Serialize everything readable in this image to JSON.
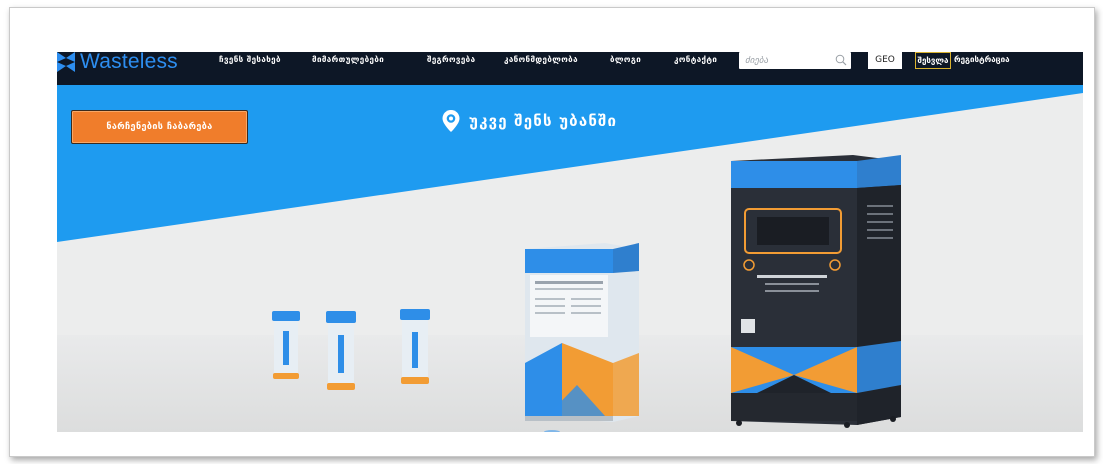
{
  "brand": {
    "name": "Wasteless"
  },
  "nav": {
    "items": [
      {
        "label": "ჩვენს შესახებ"
      },
      {
        "label": "მიმართულებები"
      },
      {
        "label": "შეგროვება"
      },
      {
        "label": "კანონმდებლობა"
      },
      {
        "label": "ბლოგი"
      },
      {
        "label": "კონტაქტი"
      }
    ],
    "search_placeholder": "ძიება",
    "language": "GEO",
    "login": "შესვლა",
    "register": "რეგისტრაცია"
  },
  "hero": {
    "cta_label": "ნარჩენების ჩაბარება",
    "title": "უკვე შენს უბანში"
  },
  "colors": {
    "navbar": "#0d1726",
    "brand_blue": "#2d8ef0",
    "hero_blue": "#1e9bf0",
    "cta_orange": "#f07d2b",
    "login_border": "#d9b22e"
  },
  "icons": {
    "logo": "wasteless-logo-icon",
    "search": "search-icon",
    "pin": "location-pin-icon"
  }
}
